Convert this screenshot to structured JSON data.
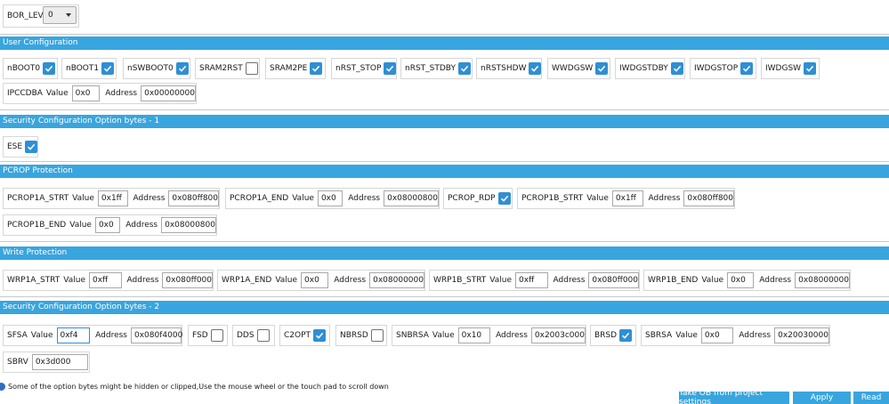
{
  "bor": {
    "label": "BOR_LEV",
    "value": "0"
  },
  "user_config": {
    "header": "User Configuration",
    "checkboxes": [
      {
        "label": "nBOOT0",
        "checked": true
      },
      {
        "label": "nBOOT1",
        "checked": true
      },
      {
        "label": "nSWBOOT0",
        "checked": true
      },
      {
        "label": "SRAM2RST",
        "checked": false
      },
      {
        "label": "SRAM2PE",
        "checked": true
      },
      {
        "label": "nRST_STOP",
        "checked": true
      },
      {
        "label": "nRST_STDBY",
        "checked": true
      },
      {
        "label": "nRSTSHDW",
        "checked": true
      },
      {
        "label": "WWDGSW",
        "checked": true
      },
      {
        "label": "IWDGSTDBY",
        "checked": true
      },
      {
        "label": "IWDGSTOP",
        "checked": true
      },
      {
        "label": "IWDGSW",
        "checked": true
      }
    ],
    "ipccdba": {
      "label": "IPCCDBA",
      "value_label": "Value",
      "value": "0x0",
      "address_label": "Address",
      "address": "0x00000000"
    }
  },
  "sec_cfg_1": {
    "header": "Security Configuration Option bytes - 1",
    "ese": {
      "label": "ESE",
      "checked": true
    }
  },
  "pcrop": {
    "header": "PCROP Protection",
    "pcrop1a_strt": {
      "label": "PCROP1A_STRT",
      "value_label": "Value",
      "value": "0x1ff",
      "address_label": "Address",
      "address": "0x080ff800"
    },
    "pcrop1a_end": {
      "label": "PCROP1A_END",
      "value_label": "Value",
      "value": "0x0",
      "address_label": "Address",
      "address": "0x08000800"
    },
    "pcrop_rdp": {
      "label": "PCROP_RDP",
      "checked": true
    },
    "pcrop1b_strt": {
      "label": "PCROP1B_STRT",
      "value_label": "Value",
      "value": "0x1ff",
      "address_label": "Address",
      "address": "0x080ff800"
    },
    "pcrop1b_end": {
      "label": "PCROP1B_END",
      "value_label": "Value",
      "value": "0x0",
      "address_label": "Address",
      "address": "0x08000800"
    }
  },
  "write_prot": {
    "header": "Write Protection",
    "wrp1a_strt": {
      "label": "WRP1A_STRT",
      "value_label": "Value",
      "value": "0xff",
      "address_label": "Address",
      "address": "0x080ff000"
    },
    "wrp1a_end": {
      "label": "WRP1A_END",
      "value_label": "Value",
      "value": "0x0",
      "address_label": "Address",
      "address": "0x08000000"
    },
    "wrp1b_strt": {
      "label": "WRP1B_STRT",
      "value_label": "Value",
      "value": "0xff",
      "address_label": "Address",
      "address": "0x080ff000"
    },
    "wrp1b_end": {
      "label": "WRP1B_END",
      "value_label": "Value",
      "value": "0x0",
      "address_label": "Address",
      "address": "0x08000000"
    }
  },
  "sec_cfg_2": {
    "header": "Security Configuration Option bytes - 2",
    "sfsa": {
      "label": "SFSA",
      "value_label": "Value",
      "value": "0xf4",
      "address_label": "Address",
      "address": "0x080f4000"
    },
    "fsd": {
      "label": "FSD",
      "checked": false
    },
    "dds": {
      "label": "DDS",
      "checked": false
    },
    "c2opt": {
      "label": "C2OPT",
      "checked": true
    },
    "nbrsd": {
      "label": "NBRSD",
      "checked": false
    },
    "snbrsa": {
      "label": "SNBRSA",
      "value_label": "Value",
      "value": "0x10",
      "address_label": "Address",
      "address": "0x2003c000"
    },
    "brsd": {
      "label": "BRSD",
      "checked": true
    },
    "sbrsa": {
      "label": "SBRSA",
      "value_label": "Value",
      "value": "0x0",
      "address_label": "Address",
      "address": "0x20030000"
    },
    "sbrv": {
      "label": "SBRV",
      "value": "0x3d000"
    }
  },
  "status": {
    "message": "Some of the option bytes might be hidden or clipped,Use the mouse wheel or the touch pad to scroll down"
  },
  "buttons": {
    "take_ob": "Take OB from project settings",
    "apply": "Apply",
    "read": "Read"
  },
  "colors": {
    "header": "#39a5de",
    "checkbox_checked": "#2f8fd3",
    "button": "#39a5de"
  }
}
